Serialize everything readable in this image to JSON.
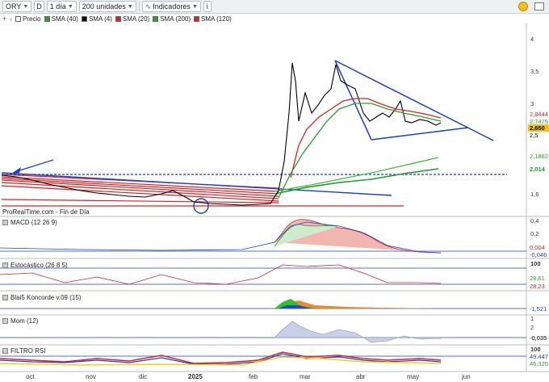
{
  "toolbar": {
    "ticker": "ORY",
    "d_label": "D",
    "period": "1 día",
    "units": "200 unidades",
    "indicators": "Indicadores",
    "info": "i"
  },
  "legend": {
    "items": [
      {
        "label": "Precio",
        "color": "#ffffff"
      },
      {
        "label": "SMA (40)",
        "color": "#2ca02c"
      },
      {
        "label": "SMA (4)",
        "color": "#000000"
      },
      {
        "label": "SMA (20)",
        "color": "#e02020"
      },
      {
        "label": "SMA (200)",
        "color": "#2ca02c"
      },
      {
        "label": "SMA (120)",
        "color": "#e02020"
      }
    ]
  },
  "price_axis": [
    "4",
    "3,5",
    "3",
    "1,6"
  ],
  "price_boxes": {
    "sma20": "2,8444",
    "sma40": "2,7479",
    "last": "2,650",
    "close": "2,5",
    "sma200": "2,1882",
    "sma120": "2,014"
  },
  "source": "ProRealTime.com - Fin de Día",
  "panes": {
    "macd": {
      "label": "MACD (12 26 9)",
      "axis": [
        "0,4",
        "0,2"
      ],
      "boxes": [
        "0,004",
        "-0,046"
      ]
    },
    "stoch": {
      "label": "Estocástico (26 8 5)",
      "axis": [
        "100"
      ],
      "boxes": [
        "28,61",
        "28,23"
      ]
    },
    "blai5": {
      "label": "Blai5 Koncorde v.09 (15)",
      "axis": [],
      "boxes": [
        "-1,521"
      ]
    },
    "mom": {
      "label": "Mom (12)",
      "axis": [
        "1",
        "2"
      ],
      "boxes": [
        "-0,035"
      ]
    },
    "rsi": {
      "label": "FILTRO RSI",
      "axis": [
        "100"
      ],
      "boxes": [
        "49,447",
        "46,325"
      ]
    }
  },
  "dates": [
    "oct",
    "nov",
    "dic",
    "2025",
    "feb",
    "mar",
    "abr",
    "may",
    "jun"
  ],
  "colors": {
    "candles": "#000000",
    "sma_red": "#e02020",
    "sma_green": "#2ca02c",
    "trendline": "#1a3fd6",
    "support": "#e02020"
  }
}
